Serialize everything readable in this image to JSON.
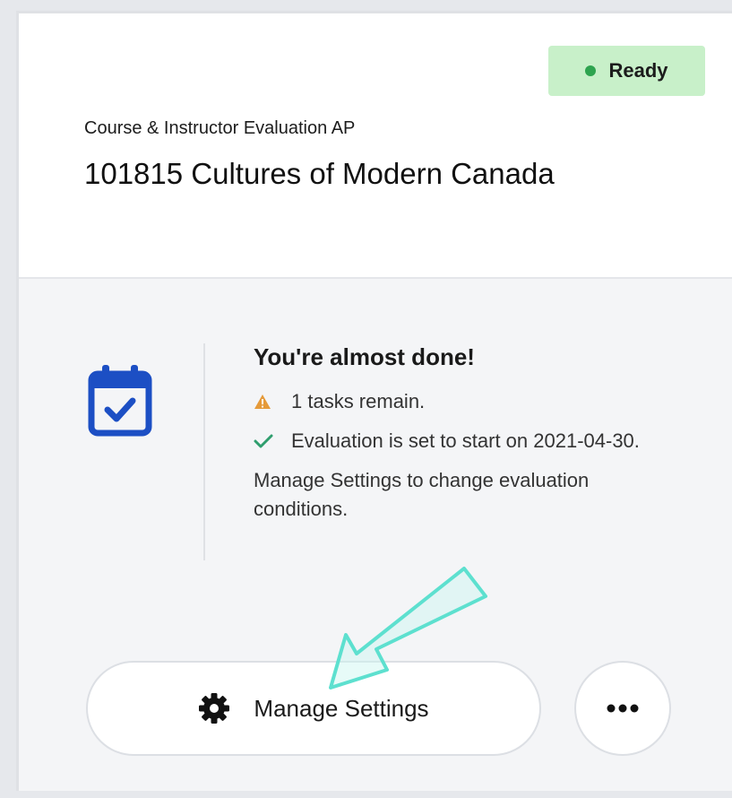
{
  "header": {
    "status": "Ready",
    "subtitle": "Course & Instructor Evaluation AP",
    "title": "101815 Cultures of Modern Canada"
  },
  "message": {
    "heading": "You're almost done!",
    "items": [
      {
        "icon": "warning-icon",
        "text": "1 tasks remain."
      },
      {
        "icon": "check-icon",
        "text": "Evaluation is set to start on 2021-04-30."
      }
    ],
    "note": "Manage Settings to change evaluation conditions."
  },
  "actions": {
    "manage_label": "Manage Settings",
    "more_label": "More options"
  },
  "colors": {
    "status_bg": "#c8f0c9",
    "status_dot": "#2ea44f",
    "calendar": "#1c4fc4",
    "warning": "#e59a3a",
    "check": "#2f9e6e",
    "annotation": "#5de0cf"
  }
}
